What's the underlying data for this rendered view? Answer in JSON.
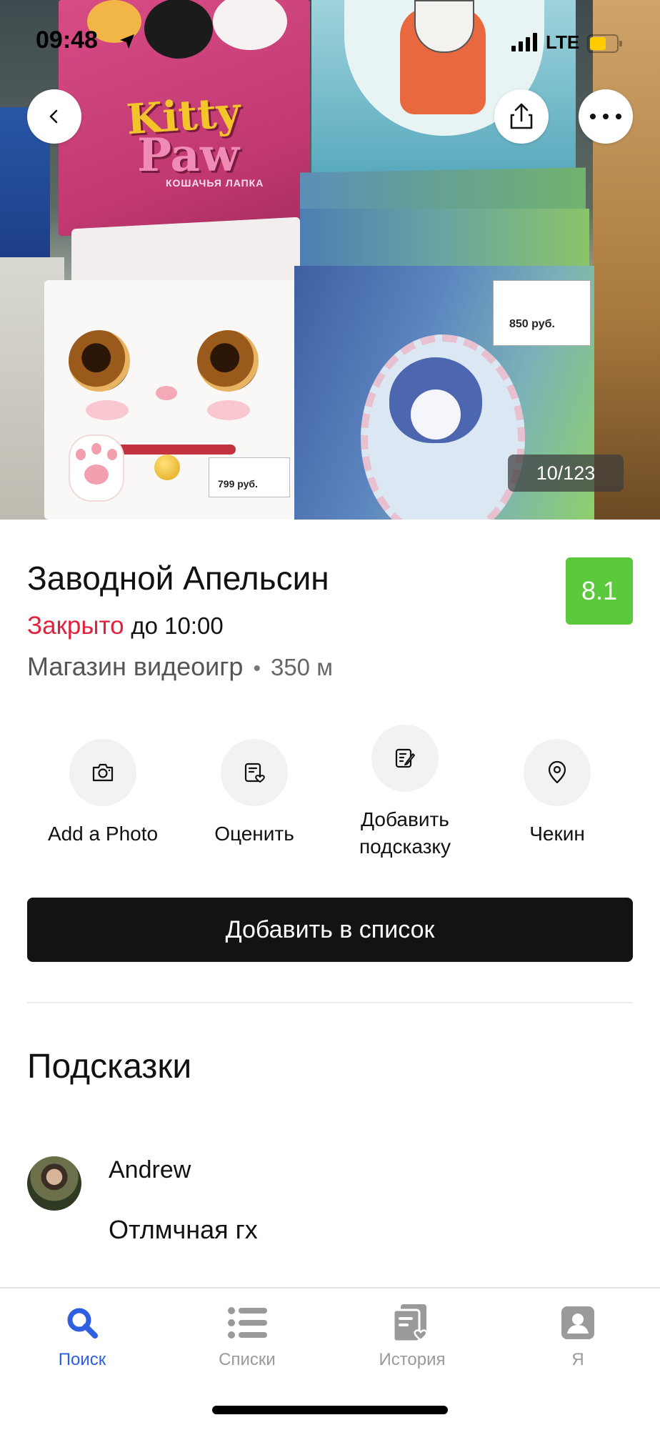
{
  "status_bar": {
    "time": "09:48",
    "network": "LTE",
    "battery_color": "#ffcc00"
  },
  "photo": {
    "counter": "10/123",
    "product_text_1": "Kitty",
    "product_text_2": "Paw",
    "product_text_3": "КОШАЧЬЯ ЛАПКА",
    "price_tag_1": "799 руб.",
    "price_tag_2": "850 руб."
  },
  "venue": {
    "name": "Заводной Апельсин",
    "status": "Закрыто",
    "hours": "до 10:00",
    "category": "Магазин видеоигр",
    "separator": "•",
    "distance": "350 м",
    "rating": "8.1",
    "rating_color": "#5cc93c"
  },
  "actions": [
    {
      "label": "Add a Photo",
      "icon": "camera-icon"
    },
    {
      "label": "Оценить",
      "icon": "rate-icon"
    },
    {
      "label": "Добавить подсказку",
      "icon": "tip-edit-icon"
    },
    {
      "label": "Чекин",
      "icon": "checkin-icon"
    }
  ],
  "add_to_list_label": "Добавить в список",
  "tips": {
    "title": "Подсказки",
    "items": [
      {
        "user": "Andrew",
        "text": "Отлмчная гх"
      }
    ]
  },
  "tabbar": {
    "items": [
      {
        "label": "Поиск",
        "icon": "search-icon",
        "active": true
      },
      {
        "label": "Списки",
        "icon": "lists-icon",
        "active": false
      },
      {
        "label": "История",
        "icon": "history-icon",
        "active": false
      },
      {
        "label": "Я",
        "icon": "profile-icon",
        "active": false
      }
    ],
    "active_color": "#2f5fe0",
    "inactive_color": "#9a9a9a"
  }
}
